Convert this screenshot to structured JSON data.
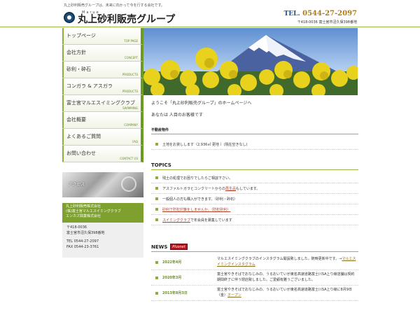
{
  "header": {
    "tagline": "丸上砂利販売グループは、未来に向かって今を行する会社です。",
    "logo_sub": "Marue",
    "logo_main": "丸上砂利販売グループ",
    "tel_label": "TEL.",
    "tel_number": "0544-27-2097",
    "address": "〒418-0036 富士宮市沼久保398番地"
  },
  "sidebar": {
    "items": [
      {
        "jp": "トップページ",
        "en": "TOP PAGE"
      },
      {
        "jp": "会社方針",
        "en": "CONCEPT"
      },
      {
        "jp": "砂利・砕石",
        "en": "PRODUCTS"
      },
      {
        "jp": "コンガラ & アスガラ",
        "en": "PRODUCTS"
      },
      {
        "jp": "富士宮マルエスイミングクラブ",
        "en": "SWIMMING"
      },
      {
        "jp": "会社概要",
        "en": "COMPANY"
      },
      {
        "jp": "よくあるご質問",
        "en": "FAQ"
      },
      {
        "jp": "お問い合わせ",
        "en": "CONTACT US"
      }
    ],
    "promo_label": "アクセス",
    "company_lines": [
      "丸上砂利販売株式会社",
      "(株)富士宮マルエスイミングクラブ",
      "エンカズ興業株式会社"
    ],
    "info_zip": "〒418-0036",
    "info_address": "富士宮市沼久保398番地",
    "info_tel": "TEL 0544-27-2097",
    "info_fax": "FAX 0544-23-3761"
  },
  "main": {
    "welcome": "ようこそ「丸上砂利販売グループ」のホームページへ",
    "visitor": "あなたは 人目のお客様です",
    "fudosan_title": "不動産物件",
    "fudosan_item": "土地をお貸しします（2,936㎡ 更地 ）(現在空きなし)",
    "topics_title": "TOPICS",
    "topics": [
      {
        "before": "残土の処理でお困りでしたらご相談下さい。",
        "link": "",
        "after": ""
      },
      {
        "before": "アスファルトガラとコンクリートからの",
        "link": "再生品",
        "after": "もしています。"
      },
      {
        "before": "一般個人の方も購入ができます。（砂利・砕石）",
        "link": "",
        "after": ""
      },
      {
        "before": "",
        "link": "砂利で防犯対策をしませんか。（防犯砂利）",
        "after": ""
      },
      {
        "before": "",
        "link": "スイミングクラブ",
        "after": "で年会員を募集しています"
      }
    ],
    "news_title": "NEWS",
    "news_badge": "Plusnet",
    "news": [
      {
        "date": "2022年4月",
        "text": "マルエスイミングクラブのインスタグラム開設致しました。随時更新中です。→",
        "link": "マルエスイミングインスタグラム"
      },
      {
        "date": "2020年3月",
        "text": "富士宮やきそばでおなじみの、うるおいていが東名高速道路富士川SA上り線店舗は契約期間終了に伴う閉店致しました。ご愛顧有難うございました。",
        "link": ""
      },
      {
        "date": "2013年8月3日",
        "text": "富士宮やきそばでおなじみの、うるおいていが東名高速道路富士川SA上り線に8月9日（金）",
        "link": "オープン"
      }
    ]
  },
  "colors": {
    "accent_green": "#7da12c",
    "tel_gold": "#b07a16",
    "badge_red": "#b3141f"
  }
}
